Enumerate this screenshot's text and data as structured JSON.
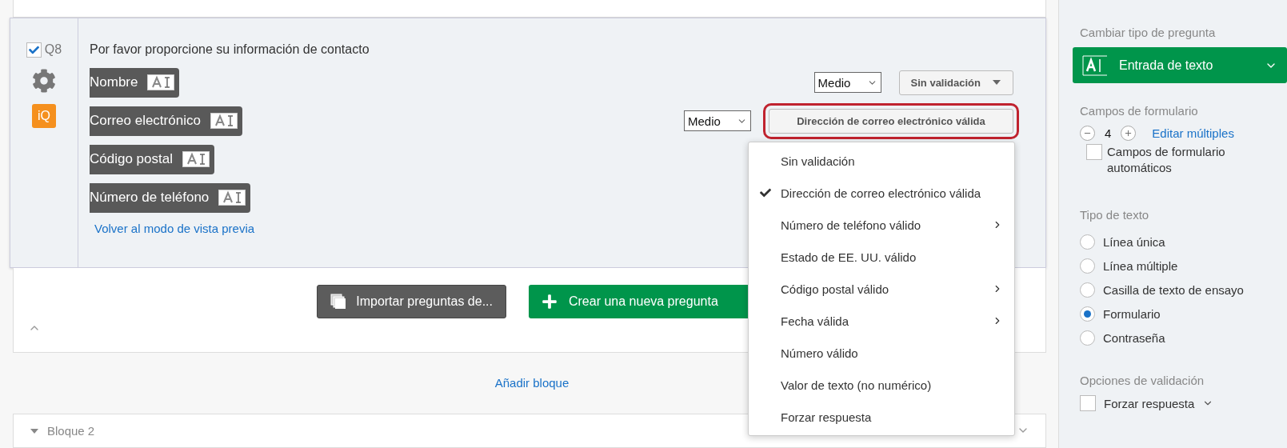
{
  "question": {
    "checked": true,
    "number": "Q8",
    "badge": "iQ",
    "text": "Por favor proporcione su información de contacto",
    "fields": [
      {
        "label": "Nombre",
        "size": "Medio",
        "validation": "Sin validación",
        "highlighted": false
      },
      {
        "label": "Correo electrónico",
        "size": "Medio",
        "validation": "Dirección de correo electrónico válida",
        "highlighted": true
      },
      {
        "label": "Código postal"
      },
      {
        "label": "Número de teléfono"
      }
    ],
    "preview_link": "Volver al modo de vista previa"
  },
  "validation_menu": {
    "items": [
      {
        "label": "Sin validación",
        "selected": false,
        "submenu": false
      },
      {
        "label": "Dirección de correo electrónico válida",
        "selected": true,
        "submenu": false
      },
      {
        "label": "Número de teléfono válido",
        "selected": false,
        "submenu": true
      },
      {
        "label": "Estado de EE. UU. válido",
        "selected": false,
        "submenu": false
      },
      {
        "label": "Código postal válido",
        "selected": false,
        "submenu": true
      },
      {
        "label": "Fecha válida",
        "selected": false,
        "submenu": true
      },
      {
        "label": "Número válido",
        "selected": false,
        "submenu": false
      },
      {
        "label": "Valor de texto (no numérico)",
        "selected": false,
        "submenu": false
      },
      {
        "label": "Forzar respuesta",
        "selected": false,
        "submenu": false
      }
    ]
  },
  "block_footer": {
    "import_button": "Importar preguntas de...",
    "create_button": "Crear una nueva pregunta"
  },
  "add_block_link": "Añadir bloque",
  "next_block": {
    "title": "Bloque 2"
  },
  "sidebar": {
    "change_type_title": "Cambiar tipo de pregunta",
    "question_type": "Entrada de texto",
    "form_fields_title": "Campos de formulario",
    "field_count": "4",
    "edit_multiple_link": "Editar múltiples",
    "auto_fields": {
      "label": "Campos de formulario automáticos",
      "checked": false
    },
    "text_type_title": "Tipo de texto",
    "text_types": [
      {
        "label": "Línea única",
        "selected": false
      },
      {
        "label": "Línea múltiple",
        "selected": false
      },
      {
        "label": "Casilla de texto de ensayo",
        "selected": false
      },
      {
        "label": "Formulario",
        "selected": true
      },
      {
        "label": "Contraseña",
        "selected": false
      }
    ],
    "validation_title": "Opciones de validación",
    "force_response": {
      "label": "Forzar respuesta",
      "checked": false
    }
  }
}
